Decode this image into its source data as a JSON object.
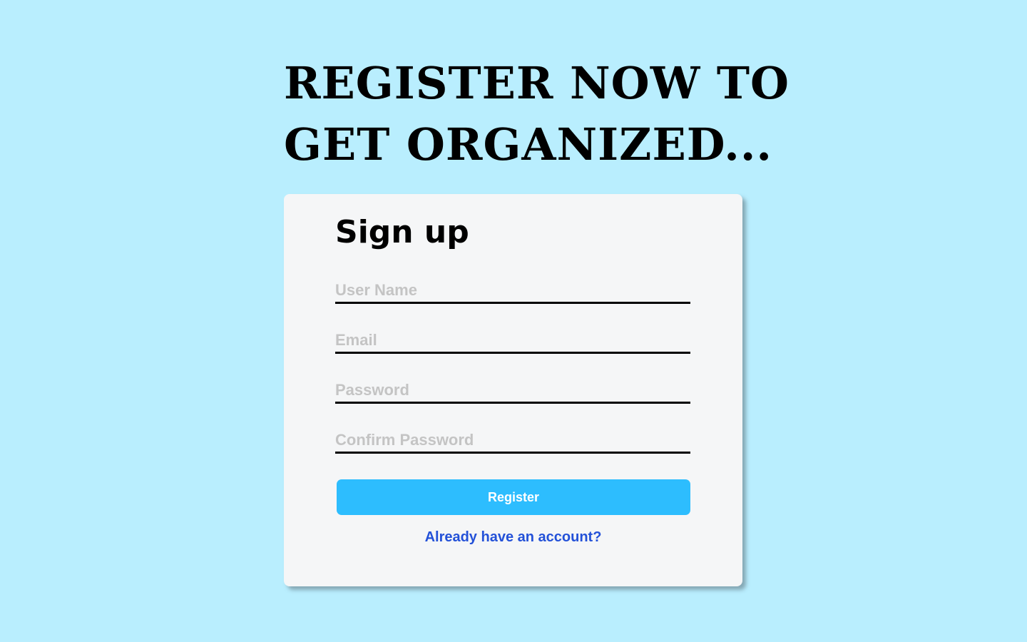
{
  "headline": {
    "line1": "REGISTER NOW TO",
    "line2": "GET ORGANIZED..."
  },
  "form": {
    "title": "Sign up",
    "fields": [
      {
        "placeholder": "User Name",
        "value": ""
      },
      {
        "placeholder": "Email",
        "value": ""
      },
      {
        "placeholder": "Password",
        "value": ""
      },
      {
        "placeholder": "Confirm Password",
        "value": ""
      }
    ],
    "submit_label": "Register",
    "login_link": "Already have an account?"
  },
  "colors": {
    "background": "#b9eefe",
    "card": "#f5f6f7",
    "button": "#2dbdfe",
    "link": "#2351d8"
  }
}
